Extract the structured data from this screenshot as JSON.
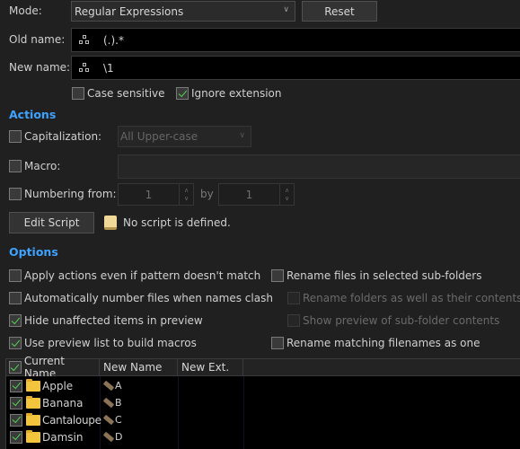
{
  "mode": {
    "label": "Mode:",
    "value": "Regular Expressions",
    "reset_label": "Reset"
  },
  "old_name": {
    "label": "Old name:",
    "value": "(.).*",
    "icon": "regex-icon"
  },
  "new_name": {
    "label": "New name:",
    "value": "\\1",
    "icon": "regex-icon"
  },
  "case_sensitive": {
    "label": "Case sensitive",
    "checked": false
  },
  "ignore_extension": {
    "label": "Ignore extension",
    "checked": true
  },
  "actions": {
    "title": "Actions",
    "capitalization": {
      "label": "Capitalization:",
      "checked": false,
      "value": "All Upper-case"
    },
    "macro": {
      "label": "Macro:",
      "checked": false,
      "value": ""
    },
    "numbering": {
      "label": "Numbering from:",
      "checked": false,
      "from": "1",
      "by_label": "by",
      "by": "1"
    },
    "edit_script_label": "Edit Script",
    "script_status": "No script is defined."
  },
  "options": {
    "title": "Options",
    "left": [
      {
        "label": "Apply actions even if pattern doesn't match",
        "checked": false
      },
      {
        "label": "Automatically number files when names clash",
        "checked": false
      },
      {
        "label": "Hide unaffected items in preview",
        "checked": true
      },
      {
        "label": "Use preview list to build macros",
        "checked": true
      }
    ],
    "right": [
      {
        "label": "Rename files in selected sub-folders",
        "checked": false,
        "disabled": false
      },
      {
        "label": "Rename folders as well as their contents",
        "checked": false,
        "disabled": true
      },
      {
        "label": "Show preview of sub-folder contents",
        "checked": false,
        "disabled": true
      },
      {
        "label": "Rename matching filenames as one",
        "checked": false,
        "disabled": false
      }
    ]
  },
  "preview": {
    "columns": [
      "Current Name",
      "New Name",
      "New Ext."
    ],
    "header_checked": true,
    "rows": [
      {
        "checked": true,
        "current": "Apple",
        "new": "A",
        "ext": ""
      },
      {
        "checked": true,
        "current": "Banana",
        "new": "B",
        "ext": ""
      },
      {
        "checked": true,
        "current": "Cantaloupe",
        "new": "C",
        "ext": ""
      },
      {
        "checked": true,
        "current": "Damsin",
        "new": "D",
        "ext": ""
      }
    ]
  },
  "colors": {
    "accent": "#3ea2ff",
    "check": "#52d452",
    "background": "#202020"
  }
}
